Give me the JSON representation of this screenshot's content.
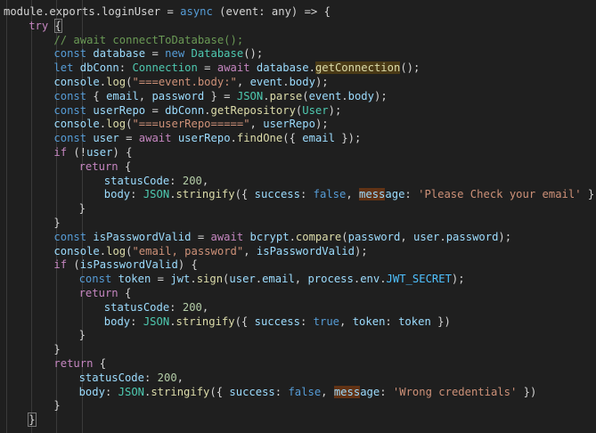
{
  "theme": {
    "bg": "#1f1f1f",
    "colors": {
      "plain": "#d4d4d4",
      "keyword": "#569cd6",
      "control": "#c586c0",
      "function": "#dcdcaa",
      "variable": "#9cdcfe",
      "type": "#4ec9b0",
      "string": "#ce9178",
      "number": "#b5cea8",
      "comment": "#6a9955",
      "constant": "#4fc1ff"
    }
  },
  "editor": {
    "lines": [
      {
        "indent": 0,
        "tokens": [
          [
            "module",
            "plain"
          ],
          [
            ".",
            "plain"
          ],
          [
            "exports",
            "plain"
          ],
          [
            ".",
            "plain"
          ],
          [
            "loginUser",
            "plain"
          ],
          [
            " = ",
            "plain"
          ],
          [
            "async",
            "keyword"
          ],
          [
            " (",
            "plain"
          ],
          [
            "event",
            "plain"
          ],
          [
            ": ",
            "plain"
          ],
          [
            "any",
            "plain"
          ],
          [
            ") => {",
            "plain"
          ]
        ]
      },
      {
        "indent": 1,
        "tokens": [
          [
            "try",
            "control"
          ],
          [
            " ",
            "plain"
          ],
          [
            "{",
            "plain",
            "bracket-box"
          ]
        ]
      },
      {
        "indent": 2,
        "tokens": [
          [
            "// await connectToDatabase();",
            "comment"
          ]
        ]
      },
      {
        "indent": 2,
        "tokens": [
          [
            "const",
            "keyword"
          ],
          [
            " ",
            "plain"
          ],
          [
            "database",
            "variable"
          ],
          [
            " = ",
            "plain"
          ],
          [
            "new",
            "keyword"
          ],
          [
            " ",
            "plain"
          ],
          [
            "Database",
            "type"
          ],
          [
            "();",
            "plain"
          ]
        ]
      },
      {
        "indent": 2,
        "tokens": [
          [
            "let",
            "keyword"
          ],
          [
            " ",
            "plain"
          ],
          [
            "dbConn",
            "variable"
          ],
          [
            ": ",
            "plain"
          ],
          [
            "Connection",
            "type"
          ],
          [
            " = ",
            "plain"
          ],
          [
            "await",
            "control"
          ],
          [
            " ",
            "plain"
          ],
          [
            "database",
            "variable"
          ],
          [
            ".",
            "plain"
          ],
          [
            "getConnection",
            "function",
            "hl-word"
          ],
          [
            "();",
            "plain"
          ]
        ]
      },
      {
        "indent": 2,
        "tokens": [
          [
            "console",
            "variable"
          ],
          [
            ".",
            "plain"
          ],
          [
            "log",
            "function"
          ],
          [
            "(",
            "plain"
          ],
          [
            "\"===event.body:\"",
            "string"
          ],
          [
            ", ",
            "plain"
          ],
          [
            "event",
            "variable"
          ],
          [
            ".",
            "plain"
          ],
          [
            "body",
            "variable"
          ],
          [
            ");",
            "plain"
          ]
        ]
      },
      {
        "indent": 2,
        "tokens": [
          [
            "const",
            "keyword"
          ],
          [
            " { ",
            "plain"
          ],
          [
            "email",
            "variable"
          ],
          [
            ", ",
            "plain"
          ],
          [
            "password",
            "variable"
          ],
          [
            " } = ",
            "plain"
          ],
          [
            "JSON",
            "type"
          ],
          [
            ".",
            "plain"
          ],
          [
            "parse",
            "function"
          ],
          [
            "(",
            "plain"
          ],
          [
            "event",
            "variable"
          ],
          [
            ".",
            "plain"
          ],
          [
            "body",
            "variable"
          ],
          [
            ");",
            "plain"
          ]
        ]
      },
      {
        "indent": 2,
        "tokens": [
          [
            "const",
            "keyword"
          ],
          [
            " ",
            "plain"
          ],
          [
            "userRepo",
            "variable"
          ],
          [
            " = ",
            "plain"
          ],
          [
            "dbConn",
            "variable"
          ],
          [
            ".",
            "plain"
          ],
          [
            "getRepository",
            "function"
          ],
          [
            "(",
            "plain"
          ],
          [
            "User",
            "type"
          ],
          [
            ");",
            "plain"
          ]
        ]
      },
      {
        "indent": 2,
        "tokens": [
          [
            "console",
            "variable"
          ],
          [
            ".",
            "plain"
          ],
          [
            "log",
            "function"
          ],
          [
            "(",
            "plain"
          ],
          [
            "\"===userRepo=====\"",
            "string"
          ],
          [
            ", ",
            "plain"
          ],
          [
            "userRepo",
            "variable"
          ],
          [
            ");",
            "plain"
          ]
        ]
      },
      {
        "indent": 2,
        "tokens": [
          [
            "const",
            "keyword"
          ],
          [
            " ",
            "plain"
          ],
          [
            "user",
            "variable"
          ],
          [
            " = ",
            "plain"
          ],
          [
            "await",
            "control"
          ],
          [
            " ",
            "plain"
          ],
          [
            "userRepo",
            "variable"
          ],
          [
            ".",
            "plain"
          ],
          [
            "findOne",
            "function"
          ],
          [
            "({ ",
            "plain"
          ],
          [
            "email",
            "variable"
          ],
          [
            " });",
            "plain"
          ]
        ]
      },
      {
        "indent": 2,
        "tokens": [
          [
            "if",
            "control"
          ],
          [
            " (!",
            "plain"
          ],
          [
            "user",
            "variable"
          ],
          [
            ") {",
            "plain"
          ]
        ]
      },
      {
        "indent": 3,
        "tokens": [
          [
            "return",
            "control"
          ],
          [
            " {",
            "plain"
          ]
        ]
      },
      {
        "indent": 4,
        "tokens": [
          [
            "statusCode",
            "variable"
          ],
          [
            ": ",
            "plain"
          ],
          [
            "200",
            "number"
          ],
          [
            ",",
            "plain"
          ]
        ]
      },
      {
        "indent": 4,
        "tokens": [
          [
            "body",
            "variable"
          ],
          [
            ": ",
            "plain"
          ],
          [
            "JSON",
            "type"
          ],
          [
            ".",
            "plain"
          ],
          [
            "stringify",
            "function"
          ],
          [
            "({ ",
            "plain"
          ],
          [
            "success",
            "variable"
          ],
          [
            ": ",
            "plain"
          ],
          [
            "false",
            "keyword"
          ],
          [
            ", ",
            "plain"
          ],
          [
            "mess",
            "variable",
            "hl-match"
          ],
          [
            "age",
            "variable"
          ],
          [
            ": ",
            "plain"
          ],
          [
            "'Please Check your email'",
            "string"
          ],
          [
            " })",
            "plain"
          ]
        ]
      },
      {
        "indent": 3,
        "tokens": [
          [
            "}",
            "plain"
          ]
        ]
      },
      {
        "indent": 2,
        "tokens": [
          [
            "}",
            "plain"
          ]
        ]
      },
      {
        "indent": 2,
        "tokens": [
          [
            "const",
            "keyword"
          ],
          [
            " ",
            "plain"
          ],
          [
            "isPasswordValid",
            "variable"
          ],
          [
            " = ",
            "plain"
          ],
          [
            "await",
            "control"
          ],
          [
            " ",
            "plain"
          ],
          [
            "bcrypt",
            "variable"
          ],
          [
            ".",
            "plain"
          ],
          [
            "compare",
            "function"
          ],
          [
            "(",
            "plain"
          ],
          [
            "password",
            "variable"
          ],
          [
            ", ",
            "plain"
          ],
          [
            "user",
            "variable"
          ],
          [
            ".",
            "plain"
          ],
          [
            "password",
            "variable"
          ],
          [
            ");",
            "plain"
          ]
        ]
      },
      {
        "indent": 2,
        "tokens": [
          [
            "console",
            "variable"
          ],
          [
            ".",
            "plain"
          ],
          [
            "log",
            "function"
          ],
          [
            "(",
            "plain"
          ],
          [
            "\"email, password\"",
            "string"
          ],
          [
            ", ",
            "plain"
          ],
          [
            "isPasswordValid",
            "variable"
          ],
          [
            ");",
            "plain"
          ]
        ]
      },
      {
        "indent": 2,
        "tokens": [
          [
            "if",
            "control"
          ],
          [
            " (",
            "plain"
          ],
          [
            "isPasswordValid",
            "variable"
          ],
          [
            ") {",
            "plain"
          ]
        ]
      },
      {
        "indent": 3,
        "tokens": [
          [
            "const",
            "keyword"
          ],
          [
            " ",
            "plain"
          ],
          [
            "token",
            "variable"
          ],
          [
            " = ",
            "plain"
          ],
          [
            "jwt",
            "variable"
          ],
          [
            ".",
            "plain"
          ],
          [
            "sign",
            "function"
          ],
          [
            "(",
            "plain"
          ],
          [
            "user",
            "variable"
          ],
          [
            ".",
            "plain"
          ],
          [
            "email",
            "variable"
          ],
          [
            ", ",
            "plain"
          ],
          [
            "process",
            "variable"
          ],
          [
            ".",
            "plain"
          ],
          [
            "env",
            "variable"
          ],
          [
            ".",
            "plain"
          ],
          [
            "JWT_SECRET",
            "constant"
          ],
          [
            ");",
            "plain"
          ]
        ]
      },
      {
        "indent": 3,
        "tokens": [
          [
            "return",
            "control"
          ],
          [
            " {",
            "plain"
          ]
        ]
      },
      {
        "indent": 4,
        "tokens": [
          [
            "statusCode",
            "variable"
          ],
          [
            ": ",
            "plain"
          ],
          [
            "200",
            "number"
          ],
          [
            ",",
            "plain"
          ]
        ]
      },
      {
        "indent": 4,
        "tokens": [
          [
            "body",
            "variable"
          ],
          [
            ": ",
            "plain"
          ],
          [
            "JSON",
            "type"
          ],
          [
            ".",
            "plain"
          ],
          [
            "stringify",
            "function"
          ],
          [
            "({ ",
            "plain"
          ],
          [
            "success",
            "variable"
          ],
          [
            ": ",
            "plain"
          ],
          [
            "true",
            "keyword"
          ],
          [
            ", ",
            "plain"
          ],
          [
            "token",
            "variable"
          ],
          [
            ": ",
            "plain"
          ],
          [
            "token",
            "variable"
          ],
          [
            " })",
            "plain"
          ]
        ]
      },
      {
        "indent": 3,
        "tokens": [
          [
            "}",
            "plain"
          ]
        ]
      },
      {
        "indent": 2,
        "tokens": [
          [
            "}",
            "plain"
          ]
        ]
      },
      {
        "indent": 2,
        "tokens": [
          [
            "return",
            "control"
          ],
          [
            " {",
            "plain"
          ]
        ]
      },
      {
        "indent": 3,
        "tokens": [
          [
            "statusCode",
            "variable"
          ],
          [
            ": ",
            "plain"
          ],
          [
            "200",
            "number"
          ],
          [
            ",",
            "plain"
          ]
        ]
      },
      {
        "indent": 3,
        "tokens": [
          [
            "body",
            "variable"
          ],
          [
            ": ",
            "plain"
          ],
          [
            "JSON",
            "type"
          ],
          [
            ".",
            "plain"
          ],
          [
            "stringify",
            "function"
          ],
          [
            "({ ",
            "plain"
          ],
          [
            "success",
            "variable"
          ],
          [
            ": ",
            "plain"
          ],
          [
            "false",
            "keyword"
          ],
          [
            ", ",
            "plain"
          ],
          [
            "mess",
            "variable",
            "hl-match"
          ],
          [
            "age",
            "variable"
          ],
          [
            ": ",
            "plain"
          ],
          [
            "'Wrong credentials'",
            "string"
          ],
          [
            " })",
            "plain"
          ]
        ]
      },
      {
        "indent": 2,
        "tokens": [
          [
            "}",
            "plain"
          ]
        ]
      },
      {
        "indent": 1,
        "tokens": [
          [
            "}",
            "plain",
            "bracket-box"
          ]
        ]
      }
    ]
  }
}
